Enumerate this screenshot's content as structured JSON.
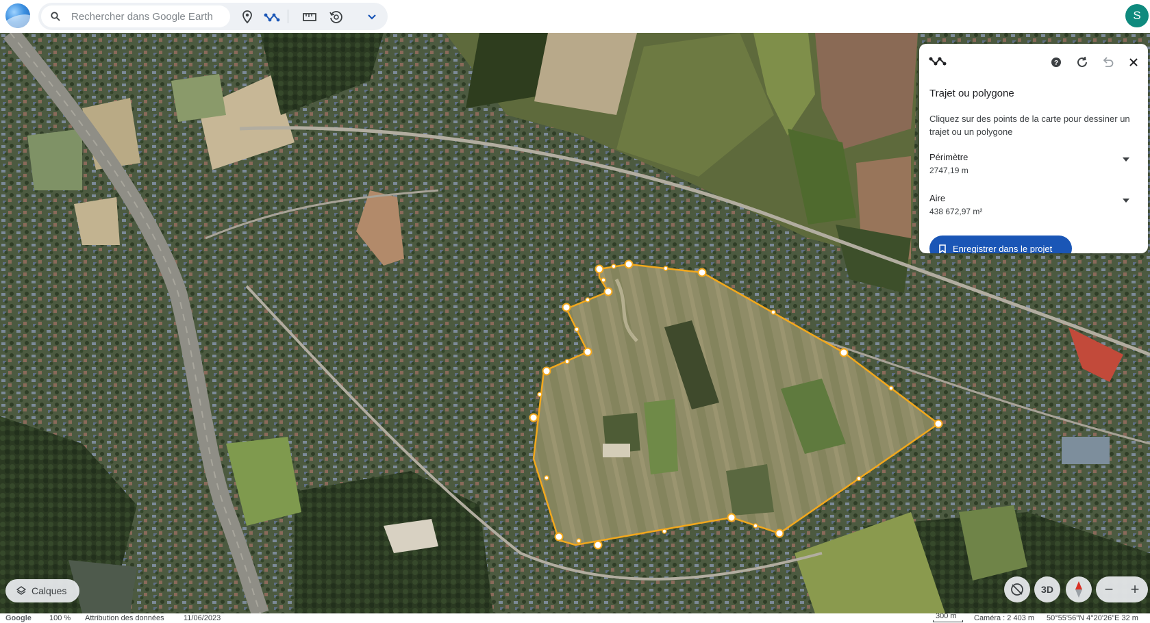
{
  "app": {
    "name": "Google Earth",
    "avatar_letter": "S"
  },
  "search": {
    "placeholder": "Rechercher dans Google Earth"
  },
  "toolbar": {
    "icons": [
      "search-icon",
      "placemark-icon",
      "path-polygon-icon",
      "ruler-icon",
      "history-icon",
      "chevron-down-icon"
    ]
  },
  "panel": {
    "title": "Trajet ou polygone",
    "description": "Cliquez sur des points de la carte pour dessiner un trajet ou un polygone",
    "perimeter": {
      "label": "Périmètre",
      "value": "2747,19 m"
    },
    "area": {
      "label": "Aire",
      "value": "438 672,97 m²"
    },
    "save_label": "Enregistrer dans le projet",
    "icons": [
      "path-polygon-icon",
      "help-icon",
      "refresh-icon",
      "undo-icon",
      "close-icon"
    ]
  },
  "layers": {
    "label": "Calques"
  },
  "controls": {
    "three_d_label": "3D",
    "zoom_out": "−",
    "zoom_in": "+"
  },
  "status": {
    "brand": "Google",
    "zoom": "100 %",
    "attribution": "Attribution des données",
    "date": "11/06/2023",
    "scale": "300 m",
    "camera": "Caméra : 2 403 m",
    "coords": "50°55'56\"N 4°20'26\"E  32 m"
  },
  "colors": {
    "polygon_stroke": "#f2a81d",
    "accent": "#1a56b6",
    "avatar": "#0f8a7e"
  }
}
